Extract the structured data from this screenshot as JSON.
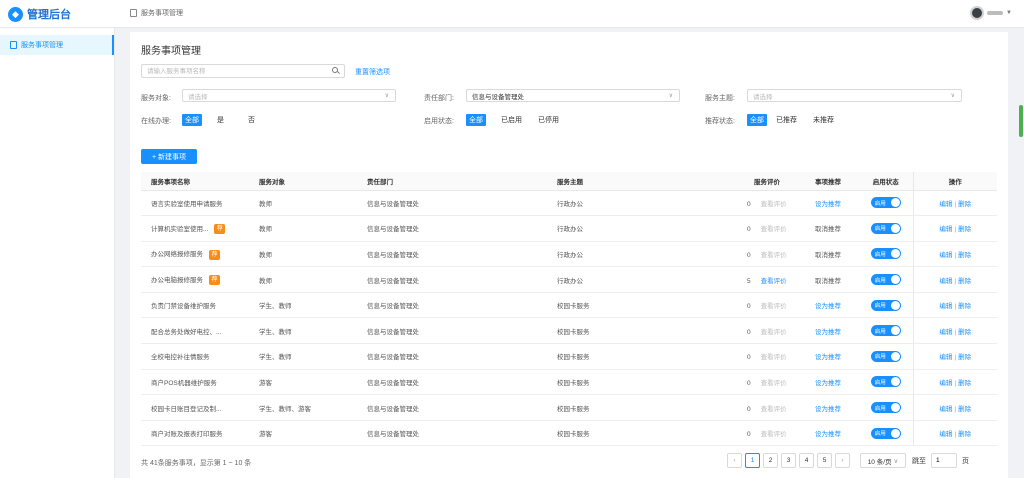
{
  "header": {
    "app_title": "管理后台",
    "breadcrumb": "服务事项管理"
  },
  "sidebar": {
    "items": [
      {
        "label": "服务事项管理"
      }
    ]
  },
  "page": {
    "title": "服务事项管理",
    "search_placeholder": "请输入服务事项名称",
    "reset_label": "重置筛选项",
    "new_button": "+ 新建事项"
  },
  "filters": {
    "audience_label": "服务对象:",
    "audience_placeholder": "请选择",
    "dept_label": "责任部门:",
    "dept_value": "信息与设备管理处",
    "theme_label": "服务主题:",
    "theme_placeholder": "请选择",
    "online_label": "在线办理:",
    "online_options": [
      "全部",
      "是",
      "否"
    ],
    "status_label": "启用状态:",
    "status_options": [
      "全部",
      "已启用",
      "已停用"
    ],
    "recommend_label": "推荐状态:",
    "recommend_options": [
      "全部",
      "已推荐",
      "未推荐"
    ]
  },
  "table": {
    "columns": [
      "服务事项名称",
      "服务对象",
      "责任部门",
      "服务主题",
      "服务评价",
      "事项推荐",
      "启用状态",
      "操作"
    ],
    "toggle_label": "启用",
    "edit_label": "编辑",
    "delete_label": "删除",
    "rec_badge": "荐",
    "rows": [
      {
        "name": "语言实验室使用申请服务",
        "rec": false,
        "audience": "教师",
        "dept": "信息与设备管理处",
        "theme": "行政办公",
        "score": "0",
        "review": "查看评价",
        "review_active": false,
        "recommend": "设为推荐",
        "recommend_link": true
      },
      {
        "name": "计算机实验室使用...",
        "rec": true,
        "audience": "教师",
        "dept": "信息与设备管理处",
        "theme": "行政办公",
        "score": "0",
        "review": "查看评价",
        "review_active": false,
        "recommend": "取消推荐",
        "recommend_link": false
      },
      {
        "name": "办公网络报修服务",
        "rec": true,
        "audience": "教师",
        "dept": "信息与设备管理处",
        "theme": "行政办公",
        "score": "0",
        "review": "查看评价",
        "review_active": false,
        "recommend": "取消推荐",
        "recommend_link": false
      },
      {
        "name": "办公电脑报修服务",
        "rec": true,
        "audience": "教师",
        "dept": "信息与设备管理处",
        "theme": "行政办公",
        "score": "5",
        "review": "查看评价",
        "review_active": true,
        "recommend": "取消推荐",
        "recommend_link": false
      },
      {
        "name": "负责门禁设备维护服务",
        "rec": false,
        "audience": "学生、教师",
        "dept": "信息与设备管理处",
        "theme": "校园卡服务",
        "score": "0",
        "review": "查看评价",
        "review_active": false,
        "recommend": "设为推荐",
        "recommend_link": true
      },
      {
        "name": "配合总务处做好电控、...",
        "rec": false,
        "audience": "学生、教师",
        "dept": "信息与设备管理处",
        "theme": "校园卡服务",
        "score": "0",
        "review": "查看评价",
        "review_active": false,
        "recommend": "设为推荐",
        "recommend_link": true
      },
      {
        "name": "全校电控补往情服务",
        "rec": false,
        "audience": "学生、教师",
        "dept": "信息与设备管理处",
        "theme": "校园卡服务",
        "score": "0",
        "review": "查看评价",
        "review_active": false,
        "recommend": "设为推荐",
        "recommend_link": true
      },
      {
        "name": "商户POS机器维护服务",
        "rec": false,
        "audience": "游客",
        "dept": "信息与设备管理处",
        "theme": "校园卡服务",
        "score": "0",
        "review": "查看评价",
        "review_active": false,
        "recommend": "设为推荐",
        "recommend_link": true
      },
      {
        "name": "校园卡日账目登记及制...",
        "rec": false,
        "audience": "学生、教师、游客",
        "dept": "信息与设备管理处",
        "theme": "校园卡服务",
        "score": "0",
        "review": "查看评价",
        "review_active": false,
        "recommend": "设为推荐",
        "recommend_link": true
      },
      {
        "name": "商户对账及报表打印服务",
        "rec": false,
        "audience": "游客",
        "dept": "信息与设备管理处",
        "theme": "校园卡服务",
        "score": "0",
        "review": "查看评价",
        "review_active": false,
        "recommend": "设为推荐",
        "recommend_link": true
      }
    ]
  },
  "footer": {
    "summary": "共 41条服务事项，显示第 1 ~ 10 条",
    "pages": [
      "1",
      "2",
      "3",
      "4",
      "5"
    ],
    "current_page": "1",
    "prev_icon": "chevron-left-icon",
    "next_icon": "chevron-right-icon",
    "page_size": "10 条/页",
    "jump_label": "跳至",
    "jump_value": "1",
    "page_unit": "页"
  },
  "colors": {
    "accent": "#1890ff",
    "badge": "#fa8c16"
  }
}
